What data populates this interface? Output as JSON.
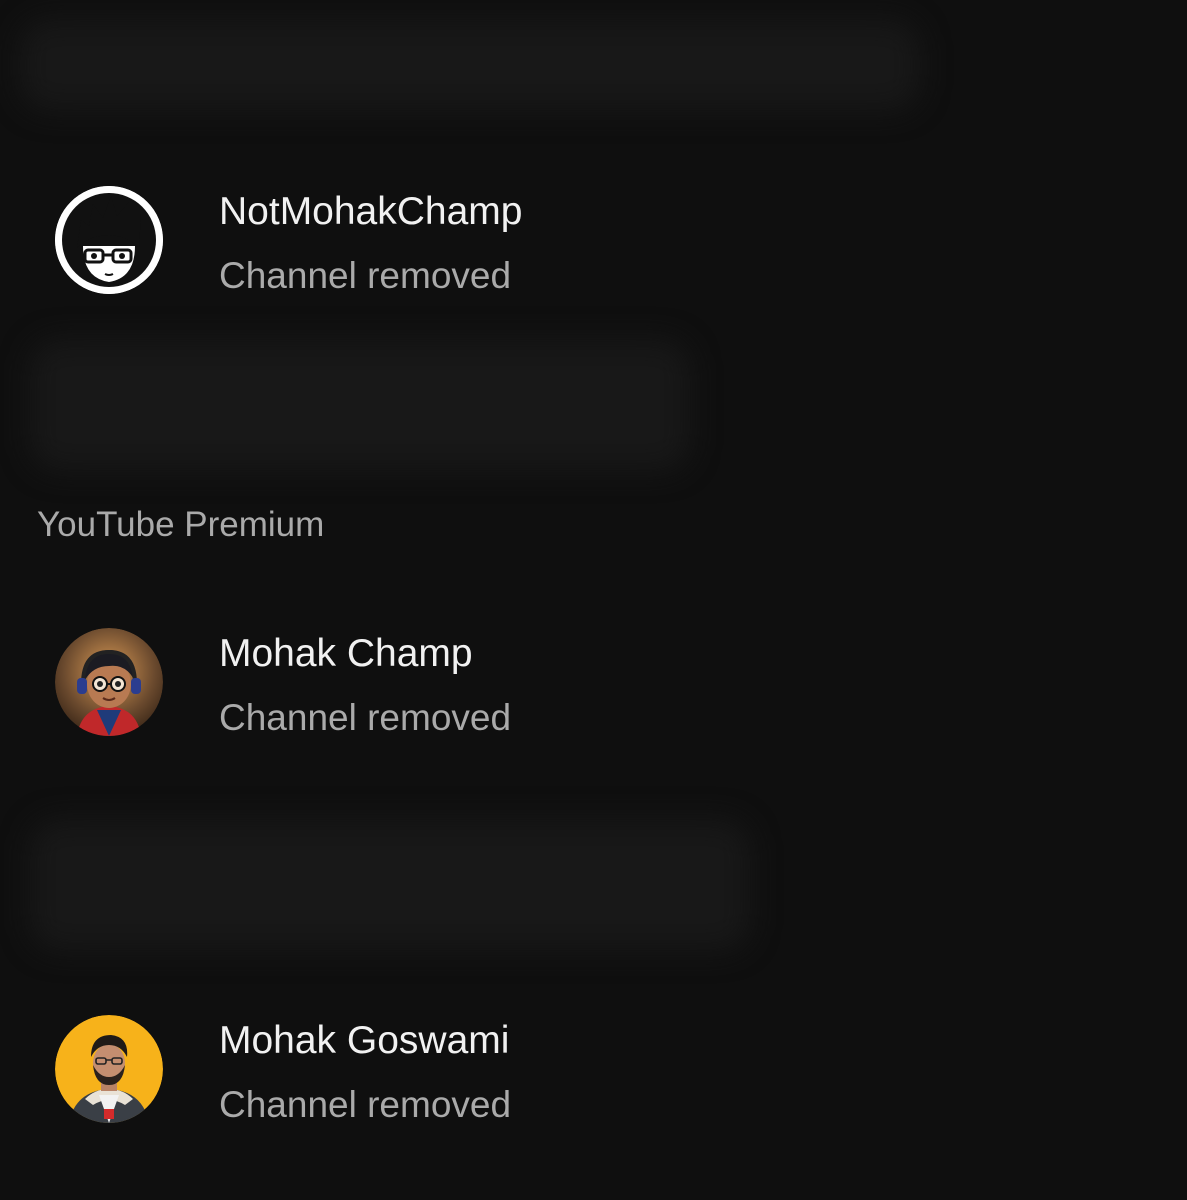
{
  "accounts_top": [
    {
      "name": "NotMohakChamp",
      "status": "Channel removed",
      "avatar_icon": "cartoon-avatar-white-icon",
      "avatar_bg": "#ffffff"
    }
  ],
  "section": {
    "title": "YouTube Premium"
  },
  "accounts_premium": [
    {
      "name": "Mohak Champ",
      "status": "Channel removed",
      "avatar_icon": "3d-cartoon-avatar-icon",
      "avatar_bg": "#6b4a2e"
    },
    {
      "name": "Mohak Goswami",
      "status": "Channel removed",
      "avatar_icon": "photo-avatar-yellow-icon",
      "avatar_bg": "#f7b21a"
    }
  ],
  "colors": {
    "background": "#0f0f0f",
    "primary_text": "#f1f1f1",
    "secondary_text": "#aaaaaa"
  }
}
